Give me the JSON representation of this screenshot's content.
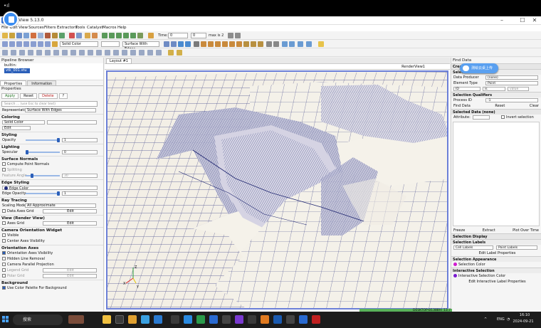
{
  "window": {
    "title": "ParaView 5.13.0",
    "top_glyph": "•ıl"
  },
  "menu": [
    "File",
    "Edit",
    "View",
    "Sources",
    "Filters",
    "Extractors",
    "Tools",
    "Catalyst",
    "Macros",
    "Help"
  ],
  "toolbar": {
    "time_label": "Time:",
    "time_value": "0",
    "step_value": "0",
    "max_label": "max is 2",
    "coloring_combo": "Solid Color",
    "representation_combo": "Surface With Edges"
  },
  "pipeline_browser": {
    "title": "Pipeline Browser",
    "items": [
      "builtin:",
      "vtk_001.vtu"
    ]
  },
  "properties": {
    "tabs": [
      "Properties",
      "Information"
    ],
    "title": "Properties",
    "apply": "Apply",
    "reset": "Reset",
    "delete": "Delete",
    "help": "?",
    "search_placeholder": "Search ... (use Esc to clear text)",
    "representation_label": "Representation",
    "representation_value": "Surface With Edges",
    "coloring_section": "Coloring",
    "coloring_value": "Solid Color",
    "edit_label": "Edit",
    "styling_section": "Styling",
    "opacity_label": "Opacity",
    "opacity_value": "1",
    "opacity_level": 1.0,
    "lighting_section": "Lighting",
    "specular_label": "Specular",
    "specular_value": "0",
    "specular_level": 0.0,
    "surface_normals_section": "Surface Normals",
    "compute_normals": "Compute Point Normals",
    "splitting": "Splitting",
    "feature_angle_label": "Feature Angle",
    "feature_angle_value": "30",
    "feature_angle_level": 0.17,
    "edge_styling_section": "Edge Styling",
    "edge_color": "Edge Color",
    "edge_opacity_label": "Edge Opacity",
    "edge_opacity_value": "1",
    "edge_opacity_level": 1.0,
    "ray_tracing_section": "Ray Tracing",
    "scaling_mode_label": "Scaling Mode",
    "scaling_mode_value": "All Approximate",
    "data_axes_grid_label": "Data Axes Grid",
    "data_axes_grid_edit": "Edit",
    "view_section": "View (Render View)",
    "axes_grid_label": "Axes Grid",
    "axes_grid_edit": "Edit",
    "camera_widget_section": "Camera Orientation Widget",
    "visible": "Visible",
    "center_axes": "Center Axes Visibility",
    "orientation_axes_section": "Orientation Axes",
    "orientation_axes_visibility": "Orientation Axes Visibility",
    "hidden_line": "Hidden Line Removal",
    "camera_parallel": "Camera Parallel Projection",
    "legend_grid": "Legend Grid",
    "legend_grid_edit": "Edit",
    "polar_grid": "Polar Grid",
    "polar_grid_edit": "Edit",
    "background_section": "Background",
    "use_palette": "Use Color Palette For Background"
  },
  "center": {
    "layout_tab": "Layout #1",
    "renderview_label": "RenderView1"
  },
  "find_data": {
    "title": "Find Data",
    "create_selection": "Create Selection",
    "selection_criteria": "Selection Criteria",
    "data_producer_label": "Data Producer",
    "data_producer_value": "(none)",
    "element_type_label": "Element Type",
    "element_type_value": "Point",
    "id_label": "ID",
    "is_label": "is",
    "value_placeholder": "value",
    "selection_qualifiers": "Selection Qualifiers",
    "process_id_label": "Process ID",
    "process_id_value": "-1",
    "find_data_btn": "Find Data",
    "reset_btn": "Reset",
    "clear_btn": "Clear",
    "selected_data": "Selected Data (none)",
    "attribute_label": "Attribute:",
    "invert_selection": "Invert selection",
    "freeze": "Freeze",
    "extract": "Extract",
    "plot_over_time": "Plot Over Time",
    "selection_display": "Selection Display",
    "selection_labels": "Selection Labels",
    "cell_labels": "Cell Labels",
    "point_labels": "Point Labels",
    "edit_label_props": "Edit Label Properties",
    "selection_appearance": "Selection Appearance",
    "selection_color": "Selection Color",
    "interactive_selection": "Interactive Selection",
    "interactive_selection_color": "Interactive Selection Color",
    "edit_interactive_label": "Edit Interactive Label Properties"
  },
  "cloud_button": "测绘云桌上传",
  "status": {
    "memory": "DESKTOP-B1388H: 13.7 GiB/31.8 GiB 43.0%"
  },
  "taskbar": {
    "search": "搜索",
    "lang": "ENG",
    "time": "16:10",
    "date": "2024-09-21"
  },
  "colors": {
    "accent": "#2b5fb9",
    "mesh_line": "#2a2f7a",
    "mesh_fill": "#f3efe6",
    "viewport_border": "#6b7fd7",
    "memory_bar": "#59b35a"
  }
}
